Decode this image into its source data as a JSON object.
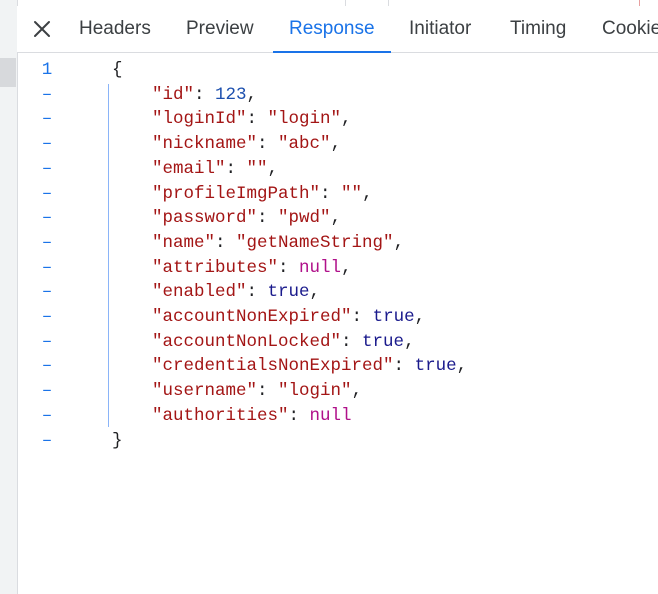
{
  "tabs": [
    {
      "label": "Headers",
      "active": false
    },
    {
      "label": "Preview",
      "active": false
    },
    {
      "label": "Response",
      "active": true
    },
    {
      "label": "Initiator",
      "active": false
    },
    {
      "label": "Timing",
      "active": false
    },
    {
      "label": "Cookie",
      "active": false
    }
  ],
  "close_icon": "close-icon",
  "gutter": {
    "first": "1",
    "fold": "–"
  },
  "brace_open": "{",
  "brace_close": "}",
  "entries": [
    {
      "key": "\"id\"",
      "value": "123",
      "type": "number",
      "comma": ","
    },
    {
      "key": "\"loginId\"",
      "value": "\"login\"",
      "type": "string",
      "comma": ","
    },
    {
      "key": "\"nickname\"",
      "value": "\"abc\"",
      "type": "string",
      "comma": ","
    },
    {
      "key": "\"email\"",
      "value": "\"\"",
      "type": "string",
      "comma": ","
    },
    {
      "key": "\"profileImgPath\"",
      "value": "\"\"",
      "type": "string",
      "comma": ","
    },
    {
      "key": "\"password\"",
      "value": "\"pwd\"",
      "type": "string",
      "comma": ","
    },
    {
      "key": "\"name\"",
      "value": "\"getNameString\"",
      "type": "string",
      "comma": ","
    },
    {
      "key": "\"attributes\"",
      "value": "null",
      "type": "null",
      "comma": ","
    },
    {
      "key": "\"enabled\"",
      "value": "true",
      "type": "bool",
      "comma": ","
    },
    {
      "key": "\"accountNonExpired\"",
      "value": "true",
      "type": "bool",
      "comma": ","
    },
    {
      "key": "\"accountNonLocked\"",
      "value": "true",
      "type": "bool",
      "comma": ","
    },
    {
      "key": "\"credentialsNonExpired\"",
      "value": "true",
      "type": "bool",
      "comma": ","
    },
    {
      "key": "\"username\"",
      "value": "\"login\"",
      "type": "string",
      "comma": ","
    },
    {
      "key": "\"authorities\"",
      "value": "null",
      "type": "null",
      "comma": ""
    }
  ],
  "colors": {
    "accent": "#1a73e8",
    "key": "#a31515",
    "number": "#1c4fae",
    "bool": "#1a1a8c",
    "null": "#b0118a"
  }
}
